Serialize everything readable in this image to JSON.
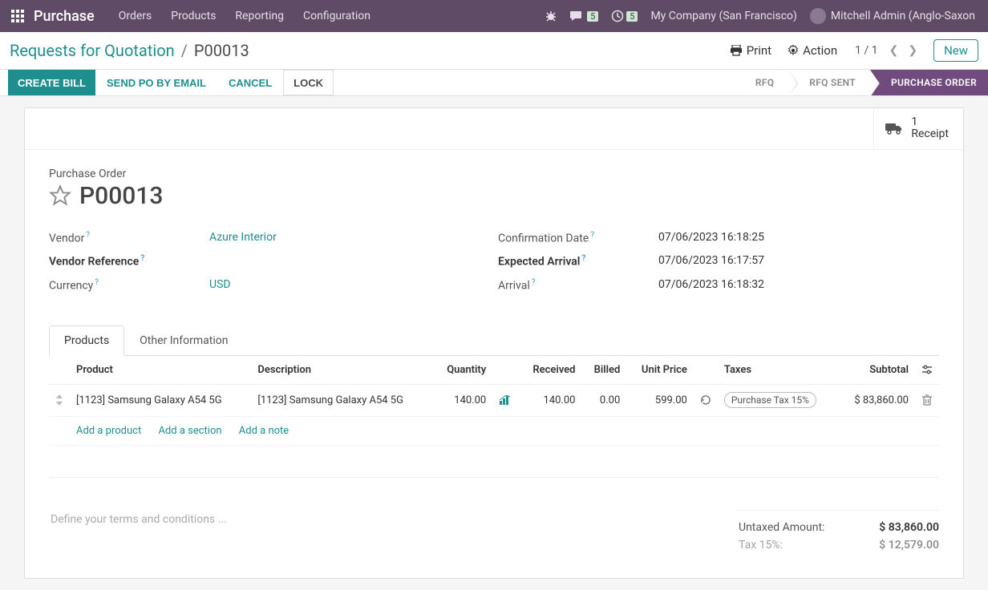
{
  "topnav": {
    "brand": "Purchase",
    "menu": [
      "Orders",
      "Products",
      "Reporting",
      "Configuration"
    ],
    "chat_badge": "5",
    "clock_badge": "5",
    "company": "My Company (San Francisco)",
    "user": "Mitchell Admin (Anglo-Saxon"
  },
  "breadcrumb": {
    "root": "Requests for Quotation",
    "current": "P00013"
  },
  "actions": {
    "print": "Print",
    "action": "Action",
    "pager": "1 / 1",
    "new": "New"
  },
  "buttons": {
    "create_bill": "CREATE BILL",
    "send_po": "SEND PO BY EMAIL",
    "cancel": "CANCEL",
    "lock": "LOCK"
  },
  "status": {
    "rfq": "RFQ",
    "rfq_sent": "RFQ SENT",
    "po": "PURCHASE ORDER"
  },
  "receipt": {
    "count": "1",
    "label": "Receipt"
  },
  "header": {
    "label": "Purchase Order",
    "name": "P00013"
  },
  "fields_left": {
    "vendor_label": "Vendor",
    "vendor_value": "Azure Interior",
    "vendor_ref_label": "Vendor Reference",
    "vendor_ref_value": "",
    "currency_label": "Currency",
    "currency_value": "USD"
  },
  "fields_right": {
    "confirm_label": "Confirmation Date",
    "confirm_value": "07/06/2023 16:18:25",
    "expected_label": "Expected Arrival",
    "expected_value": "07/06/2023 16:17:57",
    "arrival_label": "Arrival",
    "arrival_value": "07/06/2023 16:18:32"
  },
  "tabs": {
    "products": "Products",
    "other": "Other Information"
  },
  "table": {
    "headers": {
      "product": "Product",
      "description": "Description",
      "quantity": "Quantity",
      "received": "Received",
      "billed": "Billed",
      "unit_price": "Unit Price",
      "taxes": "Taxes",
      "subtotal": "Subtotal"
    },
    "row": {
      "product": "[1123] Samsung Galaxy A54 5G",
      "description": "[1123] Samsung Galaxy A54 5G",
      "quantity": "140.00",
      "received": "140.00",
      "billed": "0.00",
      "unit_price": "599.00",
      "taxes": "Purchase Tax 15%",
      "subtotal": "$ 83,860.00"
    },
    "add_product": "Add a product",
    "add_section": "Add a section",
    "add_note": "Add a note"
  },
  "terms_placeholder": "Define your terms and conditions ...",
  "totals": {
    "untaxed_label": "Untaxed Amount:",
    "untaxed_value": "$ 83,860.00",
    "tax_label": "Tax 15%:",
    "tax_value": "$ 12,579.00"
  }
}
